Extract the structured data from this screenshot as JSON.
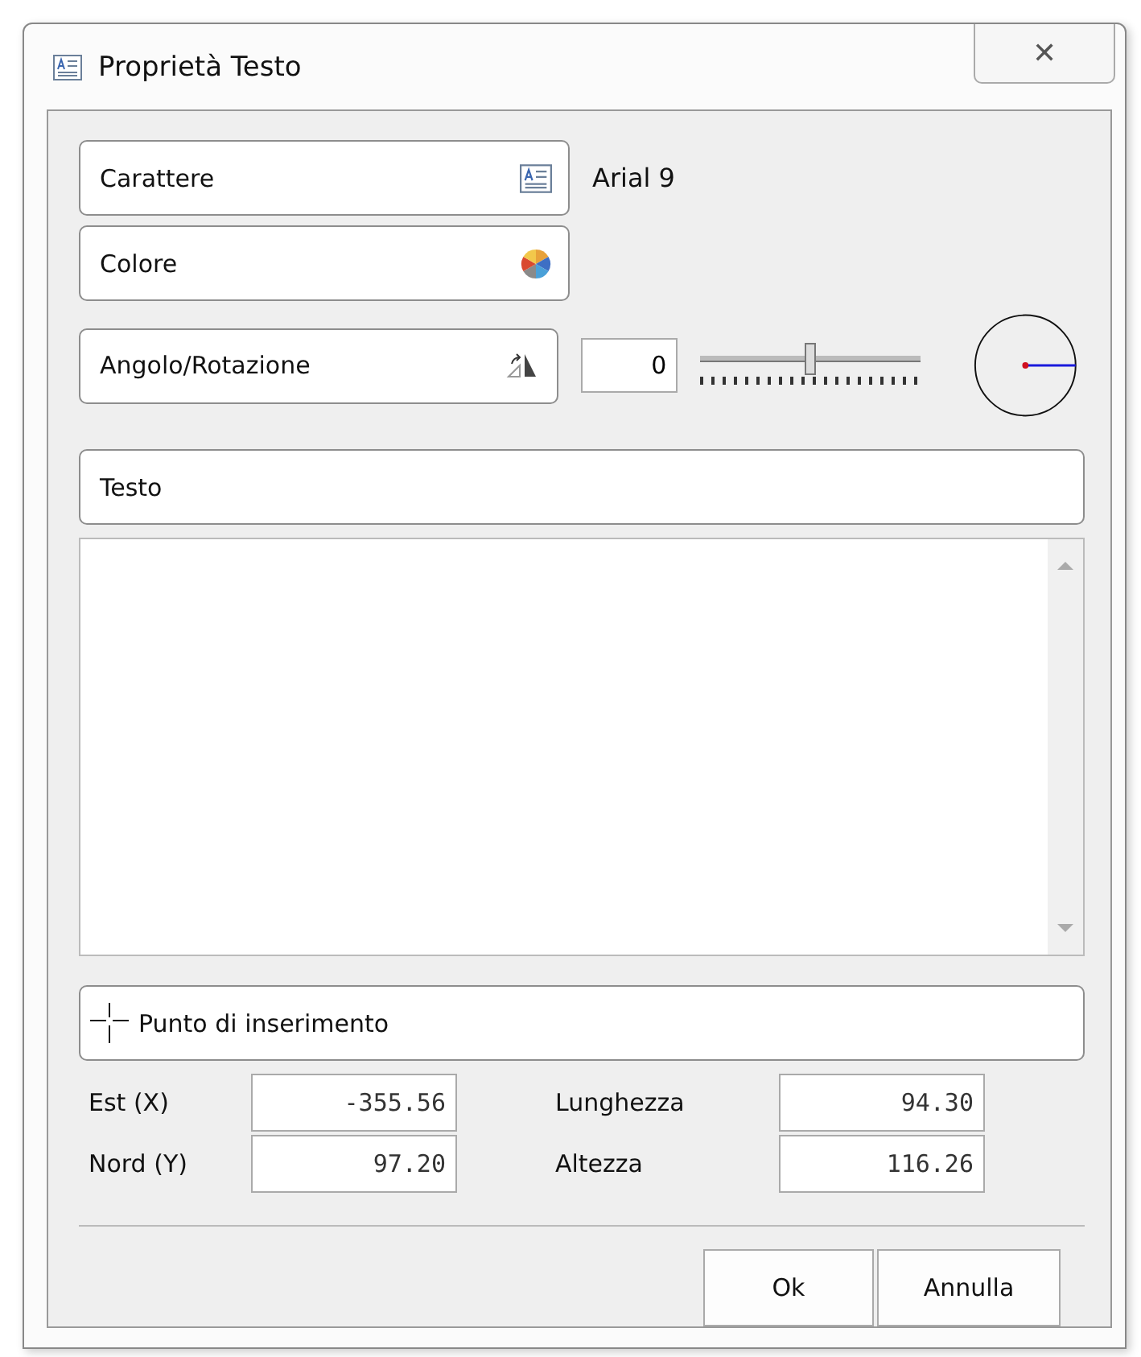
{
  "window": {
    "title": "Proprietà Testo",
    "close": "✕"
  },
  "font": {
    "label": "Carattere",
    "value": "Arial 9"
  },
  "color": {
    "label": "Colore"
  },
  "angle": {
    "label": "Angolo/Rotazione",
    "value": "0",
    "slider": {
      "level": 0.5
    }
  },
  "text": {
    "label": "Testo"
  },
  "insertion": {
    "label": "Punto di inserimento"
  },
  "fields": [
    {
      "label": "Est (X)",
      "value": "-355.56"
    },
    {
      "label": "Lunghezza",
      "value": "94.30"
    },
    {
      "label": "Nord (Y)",
      "value": "97.20"
    },
    {
      "label": "Altezza",
      "value": "116.26"
    }
  ],
  "actions": [
    "Ok",
    "Annulla"
  ]
}
